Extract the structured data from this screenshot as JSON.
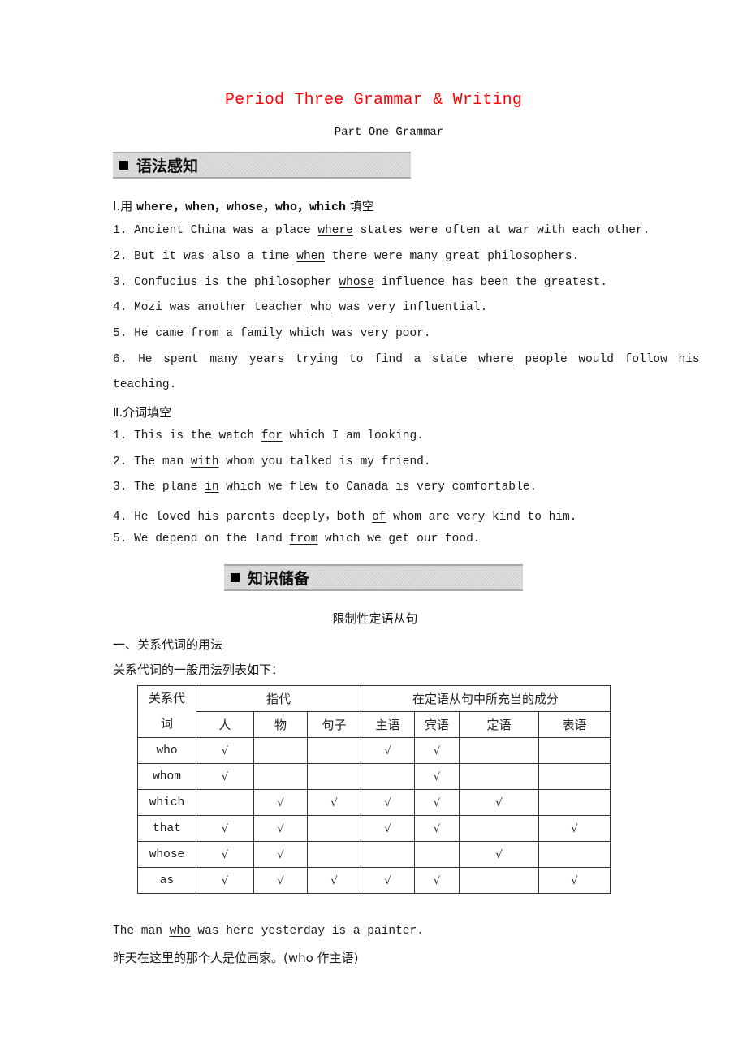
{
  "header": {
    "title": "Period Three  Grammar & Writing",
    "subtitle": "Part One  Grammar",
    "title_color": "#ff0000"
  },
  "section1": {
    "banner": "语法感知",
    "partI": {
      "heading_prefix": "Ⅰ.用 ",
      "heading_words": "where，when，whose，who，which",
      "heading_suffix": " 填空",
      "items": [
        {
          "num": "1.",
          "before": "Ancient China was a place ",
          "answer": "where",
          "after": " states were often at war with each other."
        },
        {
          "num": "2.",
          "before": "But it was also a time ",
          "answer": "when",
          "after": " there were many great philosophers."
        },
        {
          "num": "3.",
          "before": "Confucius is the philosopher ",
          "answer": "whose",
          "after": " influence has been the greatest."
        },
        {
          "num": "4.",
          "before": "Mozi was another teacher ",
          "answer": "who",
          "after": " was very influential."
        },
        {
          "num": "5.",
          "before": "He came from a family ",
          "answer": "which",
          "after": " was very poor."
        },
        {
          "num": "6.",
          "before": "He spent many years trying to find a state ",
          "answer": "where",
          "after": " people would follow his",
          "continuation": "teaching."
        }
      ]
    },
    "partII": {
      "heading": "Ⅱ.介词填空",
      "items": [
        {
          "num": "1.",
          "before": "This is the watch ",
          "answer": "for",
          "after": " which I am looking."
        },
        {
          "num": "2.",
          "before": "The man ",
          "answer": "with",
          "after": " whom you talked is my friend."
        },
        {
          "num": "3.",
          "before": "The plane ",
          "answer": "in",
          "after": " which we flew to Canada is very comfortable."
        },
        {
          "num": "4.",
          "before": "He loved his parents deeply，both ",
          "answer": "of",
          "after": " whom are very kind to him."
        },
        {
          "num": "5.",
          "before": "We depend on the land ",
          "answer": "from",
          "after": " which we get our food."
        }
      ]
    }
  },
  "section2": {
    "banner": "知识储备",
    "topic": "限制性定语从句",
    "sub_heading": "一、关系代词的用法",
    "intro": "关系代词的一般用法列表如下：",
    "table": {
      "corner_top": "关系代",
      "corner_bottom": "词",
      "group1": "指代",
      "group2": "在定语从句中所充当的成分",
      "columns": [
        "人",
        "物",
        "句子",
        "主语",
        "宾语",
        "定语",
        "表语"
      ],
      "check_mark": "√",
      "rows": [
        {
          "pronoun": "who",
          "cells": [
            true,
            false,
            false,
            true,
            true,
            false,
            false
          ]
        },
        {
          "pronoun": "whom",
          "cells": [
            true,
            false,
            false,
            false,
            true,
            false,
            false
          ]
        },
        {
          "pronoun": "which",
          "cells": [
            false,
            true,
            true,
            true,
            true,
            true,
            false
          ]
        },
        {
          "pronoun": "that",
          "cells": [
            true,
            true,
            false,
            true,
            true,
            false,
            true
          ]
        },
        {
          "pronoun": "whose",
          "cells": [
            true,
            true,
            false,
            false,
            false,
            true,
            false
          ]
        },
        {
          "pronoun": "as",
          "cells": [
            true,
            true,
            true,
            true,
            true,
            false,
            true
          ]
        }
      ]
    },
    "example": {
      "before": "The man ",
      "answer": "who",
      "after": " was here yesterday is a painter.",
      "translation": "昨天在这里的那个人是位画家。(who 作主语)"
    }
  }
}
